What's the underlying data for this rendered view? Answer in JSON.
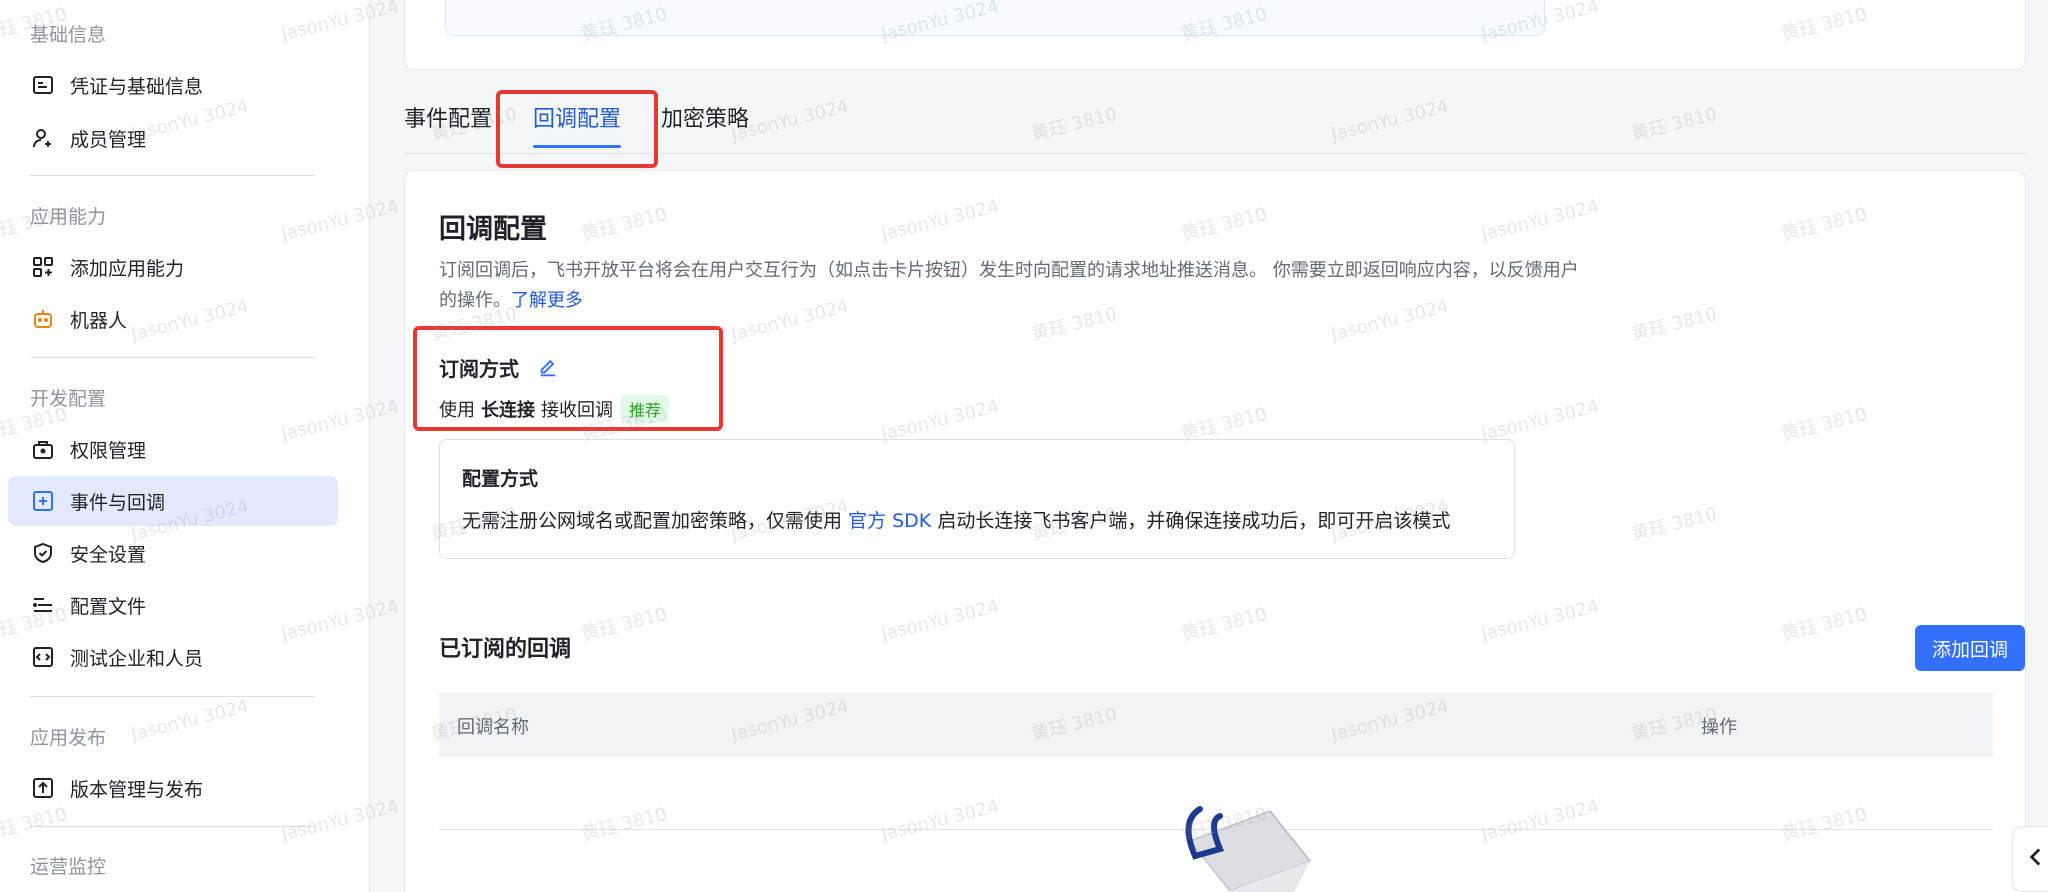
{
  "sidebar": {
    "groups": [
      {
        "title": "基础信息",
        "items": [
          "凭证与基础信息",
          "成员管理"
        ]
      },
      {
        "title": "应用能力",
        "items": [
          "添加应用能力",
          "机器人"
        ]
      },
      {
        "title": "开发配置",
        "items": [
          "权限管理",
          "事件与回调",
          "安全设置",
          "配置文件",
          "测试企业和人员"
        ]
      },
      {
        "title": "应用发布",
        "items": [
          "版本管理与发布"
        ]
      },
      {
        "title": "运营监控",
        "items": []
      }
    ]
  },
  "tabs": [
    "事件配置",
    "回调配置",
    "加密策略"
  ],
  "content": {
    "title": "回调配置",
    "desc": "订阅回调后，飞书开放平台将会在用户交互行为（如点击卡片按钮）发生时向配置的请求地址推送消息。 你需要立即返回响应内容，以反馈用户的操作。",
    "learn_more": "了解更多",
    "subscribe_title": "订阅方式",
    "sub_prefix": "使用",
    "sub_bold": "长连接",
    "sub_suffix": "接收回调",
    "sub_tag": "推荐",
    "cfg_title": "配置方式",
    "cfg_text_1": "无需注册公网域名或配置加密策略，仅需使用",
    "cfg_link": "官方 SDK",
    "cfg_text_2": "启动长连接飞书客户端，并确保连接成功后，即可开启该模式",
    "subscribed_title": "已订阅的回调",
    "add_button": "添加回调",
    "col_name": "回调名称",
    "col_op": "操作"
  },
  "watermarks": [
    "黄珏 3810",
    "JasonYu 3024"
  ],
  "colors": {
    "accent": "#3370ff",
    "highlight": "#e53935",
    "active_bg": "#e1eaff"
  }
}
